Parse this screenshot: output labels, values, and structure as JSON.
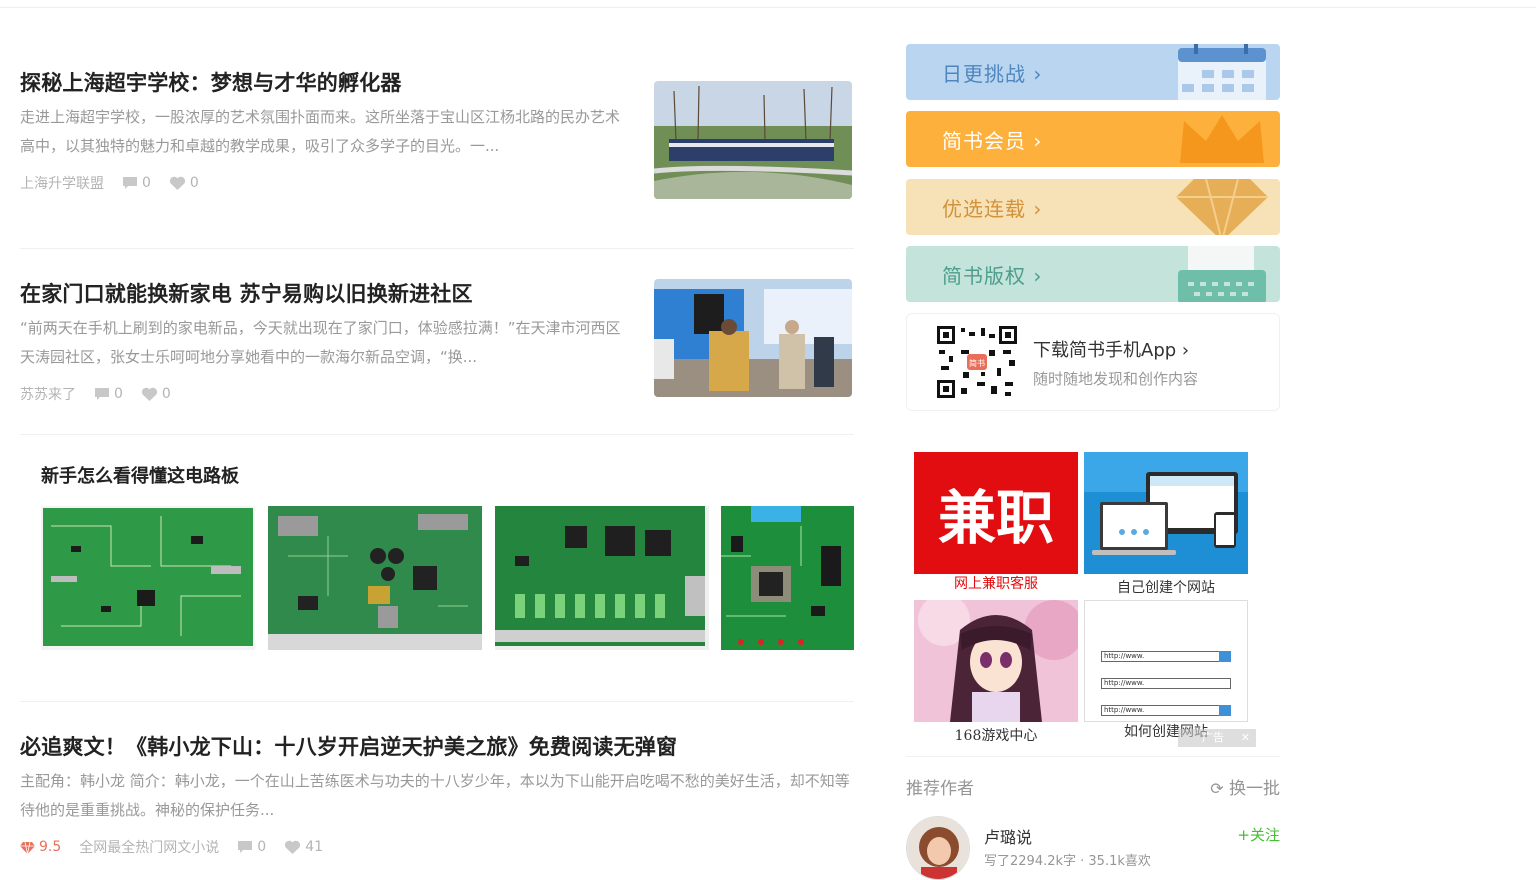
{
  "articles": [
    {
      "title": "探秘上海超宇学校：梦想与才华的孵化器",
      "abstract": "走进上海超宇学校，一股浓厚的艺术氛围扑面而来。这所坐落于宝山区江杨北路的民办艺术高中，以其独特的魅力和卓越的教学成果，吸引了众多学子的目光。一...",
      "author": "上海升学联盟",
      "comments": "0",
      "likes": "0"
    },
    {
      "title": "在家门口就能换新家电 苏宁易购以旧换新进社区",
      "abstract": "“前两天在手机上刷到的家电新品，今天就出现在了家门口，体验感拉满！”在天津市河西区天涛园社区，张女士乐呵呵地分享她看中的一款海尔新品空调，“换...",
      "author": "苏苏来了",
      "comments": "0",
      "likes": "0"
    },
    {
      "title": "必追爽文！《韩小龙下山：十八岁开启逆天护美之旅》免费阅读无弹窗",
      "abstract": "主配角：韩小龙 简介：韩小龙，一个在山上苦练医术与功夫的十八岁少年，本以为下山能开启吃喝不愁的美好生活，却不知等待他的是重重挑战。神秘的保护任务...",
      "diamond": "9.5",
      "author": "全网最全热门网文小说",
      "comments": "0",
      "likes": "41"
    }
  ],
  "pcb_block": {
    "title": "新手怎么看得懂这电路板"
  },
  "sidebar": {
    "banners": [
      {
        "label": "日更挑战",
        "color": "#b9d5ef",
        "text_color": "#4f86c0"
      },
      {
        "label": "简书会员",
        "color": "#fdb13c",
        "text_color": "#ffffff"
      },
      {
        "label": "优选连载",
        "color": "#f7e1b6",
        "text_color": "#d3923a"
      },
      {
        "label": "简书版权",
        "color": "#c3e3db",
        "text_color": "#4d9d8d"
      }
    ],
    "download": {
      "title": "下载简书手机App",
      "subtitle": "随时随地发现和创作内容",
      "qr_label": "简书"
    },
    "ads": [
      {
        "caption": "网上兼职客服",
        "image_text": "兼职"
      },
      {
        "caption": "自己创建个网站"
      },
      {
        "caption": "168游戏中心"
      },
      {
        "caption": "如何创建网站",
        "urls": [
          "http://www.",
          "http://www.",
          "http://www."
        ]
      }
    ],
    "ad_mark": "广告",
    "recommend": {
      "title": "推荐作者",
      "refresh": "换一批",
      "authors": [
        {
          "name": "卢璐说",
          "follow": "+关注",
          "stats": "写了2294.2k字 · 35.1k喜欢"
        }
      ]
    }
  },
  "colors": {
    "accent_green": "#42c02e",
    "diamond_red": "#ea6f5a"
  }
}
